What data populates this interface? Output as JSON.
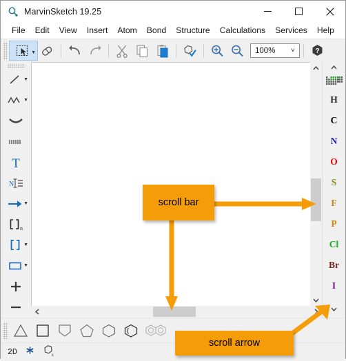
{
  "window": {
    "title": "MarvinSketch 19.25",
    "app_icon": "molecule-icon",
    "minimize_label": "─",
    "maximize_label": "☐",
    "close_label": "✕"
  },
  "menubar": {
    "items": [
      {
        "label": "File"
      },
      {
        "label": "Edit"
      },
      {
        "label": "View"
      },
      {
        "label": "Insert"
      },
      {
        "label": "Atom"
      },
      {
        "label": "Bond"
      },
      {
        "label": "Structure"
      },
      {
        "label": "Calculations"
      },
      {
        "label": "Services"
      },
      {
        "label": "Help"
      }
    ]
  },
  "toolbar": {
    "items": [
      {
        "name": "select-tool",
        "icon": "rectangle-select-icon",
        "active": true,
        "has_dropdown": true
      },
      {
        "name": "eraser-tool",
        "icon": "eraser-icon",
        "active": false,
        "has_dropdown": false
      },
      {
        "name": "undo-button",
        "icon": "undo-icon",
        "active": false,
        "has_dropdown": false
      },
      {
        "name": "redo-button",
        "icon": "redo-icon",
        "active": false,
        "has_dropdown": false
      },
      {
        "name": "cut-button",
        "icon": "scissors-icon",
        "active": false,
        "has_dropdown": false
      },
      {
        "name": "copy-button",
        "icon": "copy-icon",
        "active": false,
        "has_dropdown": false
      },
      {
        "name": "paste-button",
        "icon": "clipboard-paste-icon",
        "active": false,
        "has_dropdown": false
      },
      {
        "name": "structure-check-button",
        "icon": "structure-check-icon",
        "active": false,
        "has_dropdown": false
      },
      {
        "name": "zoom-in-button",
        "icon": "magnifier-plus-icon",
        "active": false,
        "has_dropdown": false
      },
      {
        "name": "zoom-out-button",
        "icon": "magnifier-minus-icon",
        "active": false,
        "has_dropdown": false
      }
    ],
    "zoom_value": "100%",
    "zoom_caret": "⌄",
    "help_icon": "help-hexagon-icon"
  },
  "left_tools": {
    "items": [
      {
        "name": "single-bond-tool",
        "icon": "single-bond-icon",
        "has_dropdown": true
      },
      {
        "name": "chain-tool",
        "icon": "zigzag-chain-icon",
        "has_dropdown": true
      },
      {
        "name": "arc-tool",
        "icon": "arc-icon",
        "has_dropdown": false
      },
      {
        "name": "dashed-bond-tool",
        "icon": "dotted-bond-icon",
        "has_dropdown": false
      },
      {
        "name": "text-tool",
        "icon": "text-t-icon",
        "has_dropdown": false
      },
      {
        "name": "atom-label-tool",
        "icon": "atom-label-icon",
        "has_dropdown": false
      },
      {
        "name": "reaction-arrow-tool",
        "icon": "reaction-arrow-icon",
        "has_dropdown": true
      },
      {
        "name": "repeating-unit-tool",
        "icon": "bracket-n-icon",
        "has_dropdown": false
      },
      {
        "name": "bracket-tool",
        "icon": "brackets-icon",
        "has_dropdown": true
      },
      {
        "name": "frame-tool",
        "icon": "rectangle-frame-icon",
        "has_dropdown": true
      },
      {
        "name": "increase-charge-tool",
        "icon": "plus-icon",
        "has_dropdown": false
      },
      {
        "name": "decrease-charge-tool",
        "icon": "minus-icon",
        "has_dropdown": false
      }
    ]
  },
  "element_panel": {
    "scroll_up_icon": "chevron-up-icon",
    "scroll_down_icon": "chevron-down-icon",
    "periodic_table_icon": "periodic-table-icon",
    "elements": [
      {
        "symbol": "H",
        "color": "#2b2b2b"
      },
      {
        "symbol": "C",
        "color": "#000000"
      },
      {
        "symbol": "N",
        "color": "#2222cc"
      },
      {
        "symbol": "O",
        "color": "#ee0000"
      },
      {
        "symbol": "S",
        "color": "#8c8c1e"
      },
      {
        "symbol": "F",
        "color": "#c08a1e"
      },
      {
        "symbol": "P",
        "color": "#cc8800"
      },
      {
        "symbol": "Cl",
        "color": "#0fb30f"
      },
      {
        "symbol": "Br",
        "color": "#7a2323"
      },
      {
        "symbol": "I",
        "color": "#7a14a8"
      }
    ]
  },
  "scrollbars": {
    "vertical": {
      "up_icon": "chevron-up-icon",
      "down_icon": "chevron-down-icon"
    },
    "horizontal": {
      "left_icon": "chevron-left-icon",
      "right_icon": "chevron-right-icon"
    }
  },
  "ring_bar": {
    "items": [
      {
        "name": "cyclopropane-tool",
        "icon": "triangle-icon"
      },
      {
        "name": "cyclobutane-tool",
        "icon": "square-icon"
      },
      {
        "name": "cyclopentadiene-tool",
        "icon": "pentagon-flat-icon"
      },
      {
        "name": "cyclopentane-tool",
        "icon": "pentagon-icon"
      },
      {
        "name": "cyclohexane-tool",
        "icon": "hexagon-icon"
      },
      {
        "name": "benzene-tool",
        "icon": "benzene-icon"
      },
      {
        "name": "naphthalene-tool",
        "icon": "naphthalene-icon"
      }
    ]
  },
  "statusbar": {
    "mode_label": "2D",
    "asterisk_icon": "asterisk-icon",
    "clean_icon": "clean-structure-icon"
  },
  "annotations": {
    "accent_color": "#f59c09",
    "callouts": [
      {
        "name": "scroll-bar-callout",
        "label": "scroll bar"
      },
      {
        "name": "scroll-arrow-callout",
        "label": "scroll arrow"
      }
    ]
  }
}
